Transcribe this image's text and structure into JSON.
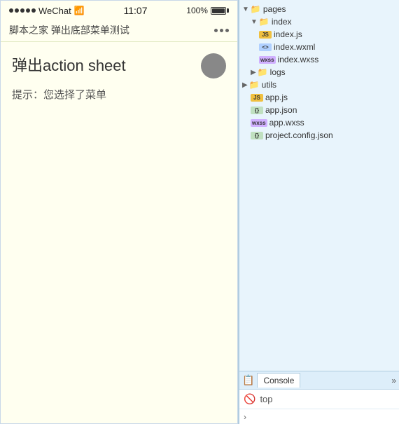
{
  "phone": {
    "signal": "•••••",
    "carrier": "WeChat",
    "wifi": "WiFi",
    "time": "11:07",
    "battery_pct": "100%",
    "nav_title": "脚本之家 弹出底部菜单测试",
    "action_title": "弹出action sheet",
    "hint_text": "提示：您选择了菜单"
  },
  "filetree": {
    "items": [
      {
        "indent": 1,
        "type": "folder",
        "label": "pages",
        "expanded": true,
        "chevron": "▼"
      },
      {
        "indent": 2,
        "type": "folder",
        "label": "index",
        "expanded": true,
        "chevron": "▼"
      },
      {
        "indent": 3,
        "type": "js",
        "label": "index.js",
        "icon": "JS"
      },
      {
        "indent": 3,
        "type": "xml",
        "label": "index.wxml",
        "icon": "<>"
      },
      {
        "indent": 3,
        "type": "wxss",
        "label": "index.wxss",
        "icon": "wxss"
      },
      {
        "indent": 2,
        "type": "folder",
        "label": "logs",
        "expanded": false,
        "chevron": "▶"
      },
      {
        "indent": 1,
        "type": "folder",
        "label": "utils",
        "expanded": false,
        "chevron": "▶"
      },
      {
        "indent": 2,
        "type": "js",
        "label": "app.js",
        "icon": "JS"
      },
      {
        "indent": 2,
        "type": "json",
        "label": "app.json",
        "icon": "{}"
      },
      {
        "indent": 2,
        "type": "wxss",
        "label": "app.wxss",
        "icon": "wxss"
      },
      {
        "indent": 2,
        "type": "json",
        "label": "project.config.json",
        "icon": "{}"
      }
    ]
  },
  "console": {
    "tab_label": "Console",
    "expand_symbol": "»",
    "input_icon": "🚫",
    "input_text": "top",
    "expand_arrow": "›"
  }
}
